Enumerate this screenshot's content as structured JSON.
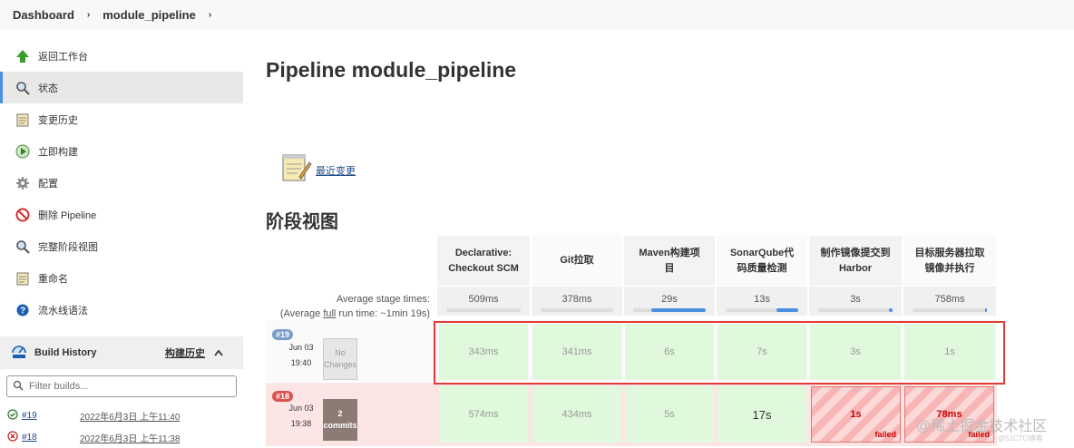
{
  "breadcrumb": {
    "items": [
      "Dashboard",
      "module_pipeline"
    ],
    "sep": "›"
  },
  "sidebar": {
    "items": [
      {
        "label": "返回工作台",
        "icon": "up-arrow-icon"
      },
      {
        "label": "状态",
        "icon": "search-icon"
      },
      {
        "label": "变更历史",
        "icon": "notepad-icon"
      },
      {
        "label": "立即构建",
        "icon": "build-icon"
      },
      {
        "label": "配置",
        "icon": "gear-icon"
      },
      {
        "label": "删除 Pipeline",
        "icon": "no-entry-icon"
      },
      {
        "label": "完整阶段视图",
        "icon": "search-icon"
      },
      {
        "label": "重命名",
        "icon": "notepad-icon"
      },
      {
        "label": "流水线语法",
        "icon": "help-icon"
      }
    ]
  },
  "build_history": {
    "title": "Build History",
    "title_cn": "构建历史",
    "filter_placeholder": "Filter builds...",
    "builds": [
      {
        "num": "#19",
        "date": "2022年6月3日 上午11:40",
        "status": "success"
      },
      {
        "num": "#18",
        "date": "2022年6月3日 上午11:38",
        "status": "failed"
      }
    ]
  },
  "main": {
    "title": "Pipeline module_pipeline",
    "recent_changes": "最近变更",
    "stage_view_title": "阶段视图",
    "avg_label_1": "Average stage times:",
    "avg_label_2_pre": "(Average ",
    "avg_label_2_link": "full",
    "avg_label_2_post": " run time: ~1min 19s)"
  },
  "stages": [
    {
      "name_1": "Declarative:",
      "name_2": "Checkout SCM",
      "avg": "509ms",
      "avg_fill": 0.0
    },
    {
      "name_1": "Git拉取",
      "name_2": "",
      "avg": "378ms",
      "avg_fill": 0.0
    },
    {
      "name_1": "Maven构建项",
      "name_2": "目",
      "avg": "29s",
      "avg_fill": 0.75
    },
    {
      "name_1": "SonarQube代",
      "name_2": "码质量检测",
      "avg": "13s",
      "avg_fill": 0.3
    },
    {
      "name_1": "制作镜像提交到",
      "name_2": "Harbor",
      "avg": "3s",
      "avg_fill": 0.05
    },
    {
      "name_1": "目标服务器拉取",
      "name_2": "镜像并执行",
      "avg": "758ms",
      "avg_fill": 0.02
    }
  ],
  "runs": [
    {
      "badge": "#19",
      "date": "Jun 03",
      "time": "19:40",
      "changes_1": "No",
      "changes_2": "Changes",
      "cells": [
        "343ms",
        "341ms",
        "6s",
        "7s",
        "3s",
        "1s"
      ],
      "states": [
        "ok",
        "ok",
        "ok",
        "ok",
        "ok",
        "ok"
      ]
    },
    {
      "badge": "#18",
      "date": "Jun 03",
      "time": "19:38",
      "changes_1": "2",
      "changes_2": "commits",
      "cells": [
        "574ms",
        "434ms",
        "5s",
        "17s",
        "1s",
        "78ms"
      ],
      "states": [
        "ok",
        "ok",
        "ok",
        "ok",
        "failed",
        "failed"
      ],
      "failed_tag": "failed"
    }
  ],
  "watermark": "@稀土掘金技术社区",
  "watermark_sub": "@51CTO博客",
  "colors": {
    "accent": "#4a90e2",
    "success_bg": "#e0f9dc",
    "failed_bg": "#f7b5b5",
    "highlight": "#e53935"
  }
}
